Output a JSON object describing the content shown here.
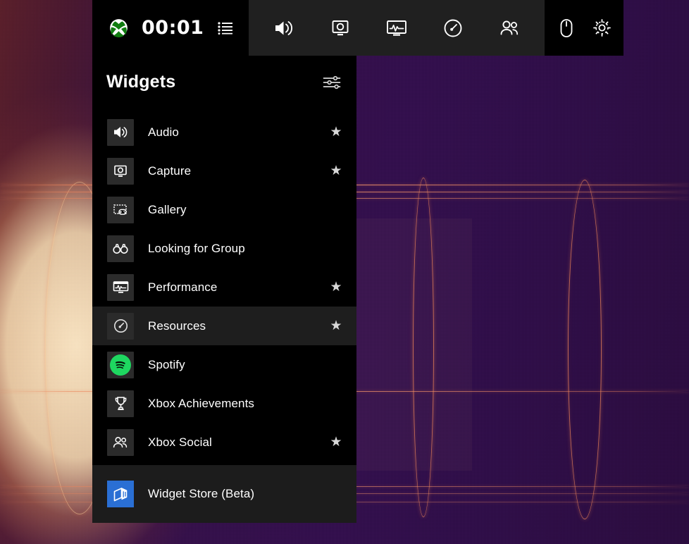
{
  "toolbar": {
    "xbox_logo": "xbox-logo-icon",
    "clock": "00:01",
    "menu_icon": "list-menu-icon",
    "buttons": [
      {
        "name": "audio-icon",
        "label": "Audio"
      },
      {
        "name": "capture-icon",
        "label": "Capture"
      },
      {
        "name": "performance-icon",
        "label": "Performance"
      },
      {
        "name": "resources-icon",
        "label": "Resources"
      },
      {
        "name": "xbox-social-icon",
        "label": "Xbox Social"
      }
    ],
    "right_buttons": [
      {
        "name": "mouse-icon",
        "label": "Mouse"
      },
      {
        "name": "settings-icon",
        "label": "Settings"
      }
    ]
  },
  "panel": {
    "title": "Widgets",
    "header_action_icon": "sliders-settings-icon",
    "items": [
      {
        "label": "Audio",
        "icon": "speaker-icon",
        "pinned": true,
        "selected": false
      },
      {
        "label": "Capture",
        "icon": "capture-icon",
        "pinned": true,
        "selected": false
      },
      {
        "label": "Gallery",
        "icon": "gallery-icon",
        "pinned": false,
        "selected": false
      },
      {
        "label": "Looking for Group",
        "icon": "binoculars-icon",
        "pinned": false,
        "selected": false
      },
      {
        "label": "Performance",
        "icon": "performance-icon",
        "pinned": true,
        "selected": false
      },
      {
        "label": "Resources",
        "icon": "gauge-icon",
        "pinned": true,
        "selected": true
      },
      {
        "label": "Spotify",
        "icon": "spotify-icon",
        "pinned": false,
        "selected": false
      },
      {
        "label": "Xbox Achievements",
        "icon": "trophy-icon",
        "pinned": false,
        "selected": false
      },
      {
        "label": "Xbox Social",
        "icon": "people-icon",
        "pinned": true,
        "selected": false
      }
    ],
    "store": {
      "label": "Widget Store (Beta)",
      "icon": "widget-store-icon"
    },
    "star_glyph": "★"
  },
  "colors": {
    "panel_background": "#000000",
    "selected_row": "#1e1e1e",
    "store_background": "#1c1c1c",
    "icon_tile": "#2b2b2b",
    "toolbar_dark": "#202020",
    "toolbar_black": "#000000",
    "spotify_green": "#1ed760",
    "store_blue": "#2a6fd4",
    "text_primary": "#ffffff",
    "star": "#d8d8d8",
    "wallpaper_purple": "#330f4d",
    "wallpaper_accent": "#e47e58"
  }
}
